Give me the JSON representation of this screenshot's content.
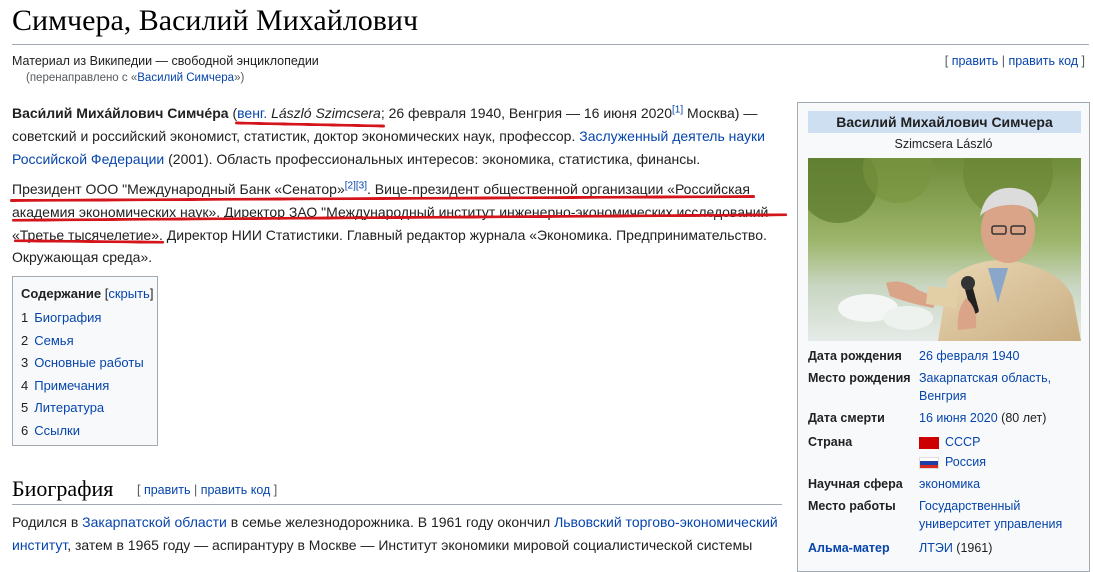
{
  "page": {
    "title": "Симчера, Василий Михайлович",
    "site_sub": "Материал из Википедии — свободной энциклопедии",
    "redirect_prefix": "(перенаправлено с «",
    "redirect_link": "Василий Симчера",
    "redirect_suffix": "»)",
    "edit_open": "[ ",
    "edit_label": "править",
    "edit_sep": " | ",
    "edit_code_label": "править код",
    "edit_close": " ]"
  },
  "intro": {
    "name": "Васи́лий Миха́йлович Симче́ра",
    "paren_open": " (",
    "hungarian_abbr": "венг.",
    "hungarian_name": "László Szimcsera",
    "born_text": "; 26 февраля 1940, Венгрия — 16 июня 2020",
    "ref1": "[1]",
    "rest1": " Москва) — советский и российский экономист, статистик, доктор экономических наук, профессор. ",
    "honor_link": "Заслуженный деятель науки Российской Федерации",
    "rest2": " (2001). Область профессиональных интересов: экономика, статистика, финансы.",
    "para2_a": "Президент ООО \"Международный Банк «Сенатор»",
    "ref2": "[2]",
    "ref3": "[3]",
    "para2_b": ". Вице-президент общественной организации «Российская академия экономических наук». Директор ЗАО \"Международный институт инженерно-экономических исследований «Третье тысячелетие». Директор НИИ Статистики. Главный редактор журнала «Экономика. Предпринимательство. Окружающая среда»."
  },
  "toc": {
    "title": "Содержание",
    "toggle_open": " [",
    "toggle": "скрыть",
    "toggle_close": "]",
    "items": [
      {
        "num": "1",
        "label": "Биография"
      },
      {
        "num": "2",
        "label": "Семья"
      },
      {
        "num": "3",
        "label": "Основные работы"
      },
      {
        "num": "4",
        "label": "Примечания"
      },
      {
        "num": "5",
        "label": "Литература"
      },
      {
        "num": "6",
        "label": "Ссылки"
      }
    ]
  },
  "section": {
    "heading": "Биография",
    "text_a": "Родился в ",
    "link_a": "Закарпатской области",
    "text_b": " в семье железнодорожника. В 1961 году окончил ",
    "link_b": "Львовский торгово-экономический институт",
    "text_c": ", затем в 1965 году — аспирантуру в Москве — Институт экономики мировой социалистической системы"
  },
  "infobox": {
    "heading": "Василий Михайлович Симчера",
    "subname": "Szimcsera László",
    "rows": [
      {
        "label": "Дата рождения",
        "value": "26 февраля 1940",
        "note": ""
      },
      {
        "label": "Место рождения",
        "value": "Закарпатская область, Венгрия",
        "note": ""
      },
      {
        "label": "Дата смерти",
        "value": "16 июня 2020",
        "note": " (80 лет)"
      },
      {
        "label": "Страна",
        "value": "СССР",
        "value2": "Россия"
      },
      {
        "label": "Научная сфера",
        "value": "экономика",
        "note": ""
      },
      {
        "label": "Место работы",
        "value": "Государственный университет управления",
        "note": ""
      },
      {
        "label": "Альма-матер",
        "value": "ЛТЭИ",
        "note": " (1961)"
      }
    ]
  },
  "colors": {
    "link": "#0645ad",
    "underline": "#d4151b",
    "infobox_header": "#cedff2",
    "ussr_flag": "#cc0000"
  }
}
